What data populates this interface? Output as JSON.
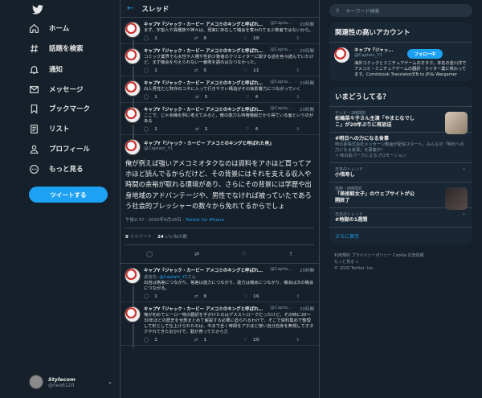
{
  "nav": {
    "items": [
      {
        "label": "ホーム",
        "icon": "home-icon"
      },
      {
        "label": "話題を検索",
        "icon": "hashtag-icon"
      },
      {
        "label": "通知",
        "icon": "bell-icon"
      },
      {
        "label": "メッセージ",
        "icon": "mail-icon"
      },
      {
        "label": "ブックマーク",
        "icon": "bookmark-icon"
      },
      {
        "label": "リスト",
        "icon": "list-icon"
      },
      {
        "label": "プロフィール",
        "icon": "person-icon"
      },
      {
        "label": "もっと見る",
        "icon": "more-circle-icon"
      }
    ],
    "tweet_button": "ツイートする",
    "user": {
      "name": "Stylecom",
      "handle": "@neo6120"
    }
  },
  "main": {
    "header": "スレッド",
    "tweets": [
      {
        "name": "キャプY『ジャック・カービー アメコミのキングと呼ばれた男』",
        "handle": "@Capta...",
        "time": "20時間",
        "text": "まず、宇宙人や異種族や神々は、現実に存在して機会を奪われてる少数者ではないから。",
        "reply": "1",
        "rt": "8",
        "like": "18"
      },
      {
        "name": "キャプY『ジャック・カービー アメコミのキングと呼ばれた男』",
        "handle": "@Capta...",
        "time": "20時間",
        "text": "コミック業界でも女性や人種や性的少数者のクリエイターに関する話を色々読んでいたけど、まず機会を与えられない一番敗を語のはなつなかった。",
        "reply": "1",
        "rt": "5",
        "like": "11"
      },
      {
        "name": "キャプY『ジャック・カービー アメコミのキングと呼ばれた男』",
        "handle": "@Capta...",
        "time": "20時間",
        "text": "白人男性だと既存のコネに入って行きやすい構造がその後影響力につながっていく",
        "reply": "1",
        "rt": "5",
        "like": "4"
      },
      {
        "name": "キャプY『ジャック・カービー アメコミのキングと呼ばれた男』",
        "handle": "@Capta...",
        "time": "20時間",
        "text": "ここで、じゃあ機を例に考えてみると、俺の能力も特権階級だから得ている面というのがある",
        "reply": "1",
        "rt": "2",
        "like": "4"
      }
    ],
    "focus": {
      "name": "キャプY『ジャック・カービー アメコミのキングと呼ばれた男』",
      "handle": "@Captain_Y1",
      "text": "俺が例えば強いアメコミオタクなのは資料をアホほど買ってアホほど読んでるからだけど、その背景にはそれを支える収入や時間の余裕が取れる環境があり、さらにその背景には学歴や出身地域のアドバンテージや、男性でなければ被っていたであろう社会的プレッシャーの数々から免れてるからでしょ",
      "timestamp": "午後2:37 · 2020年6月28日 · ",
      "client": "Twitter for iPhone",
      "retweets": "8",
      "retweets_label": "リツイート",
      "likes": "24",
      "likes_label": "いいねの数"
    },
    "replies": [
      {
        "name": "キャプY『ジャック・カービー アメコミのキングと呼ばれた男』",
        "handle": "@Capta...",
        "time": "20時間",
        "reply_to_prefix": "返信先: ",
        "reply_to": "@Captain_Y1",
        "reply_to_suffix": "さん",
        "text": "出自は格差につながり、格差は能力につながり、能力は機会につながり、機会は次の機会につながる。",
        "reply": "1",
        "rt": "9",
        "like": "16"
      },
      {
        "name": "キャプY『ジャック・カービー アメコミのキングと呼ばれた男』",
        "handle": "@Capta...",
        "time": "20時間",
        "text": "俺が初めてヒーロー物の翻訳を手がけたのはデスストロークだったけど、その時に20〜30年ほどの歴史を全部まとめて解説する必要に迫られるわけで、そこで資料集めで整理して形として仕上げられたのは、今まで全く時間をアホほど使い自分自身を無視してオタクやれてきたおかげで、勤が育ってたからだ",
        "reply": "1",
        "rt": "1",
        "like": "10"
      }
    ]
  },
  "right": {
    "search_placeholder": "キーワード検索",
    "suggest_title": "関連性の高いアカウント",
    "account": {
      "name": "キャプY『ジャッ...",
      "handle": "@Captain_Y1",
      "follow": "フォロー中",
      "bio": "海外コミックとミニチュアゲームのオタク。本名の金川洋でアメコミ・ミニチュアゲームの翻訳・ライター業に携わってます。Comicbook Translator(EN to JP)& Wargamer"
    },
    "trends_title": "いまどうしてる？",
    "trends": [
      {
        "ctx": "テレビ・2時間前",
        "title": "松嶋菜々子さん主演「やまとなでしこ」が20年ぶりに再放送",
        "desc": ""
      },
      {
        "ctx": "",
        "title": "#明日への力になる食事",
        "desc": "味の素株式会社メッセージ動画が配信スタート。みんなの「明日への力になる食事」を募集中！",
        "promo": "味の素パークによるプロモーション"
      },
      {
        "ctx": "日本のトレンド",
        "title": "小惜寿し",
        "desc": ""
      },
      {
        "ctx": "芸術・8時間前",
        "title": "「美術館女子」のウェブサイトが公開終了",
        "desc": ""
      },
      {
        "ctx": "日本のトレンド",
        "title": "#地獄の1週間",
        "desc": ""
      }
    ],
    "show_more": "さらに表示",
    "footer": [
      "利用規約 プライバシーポリシー Cookie 広告情報",
      "もっと見る ∨",
      "© 2020 Twitter, Inc."
    ]
  }
}
